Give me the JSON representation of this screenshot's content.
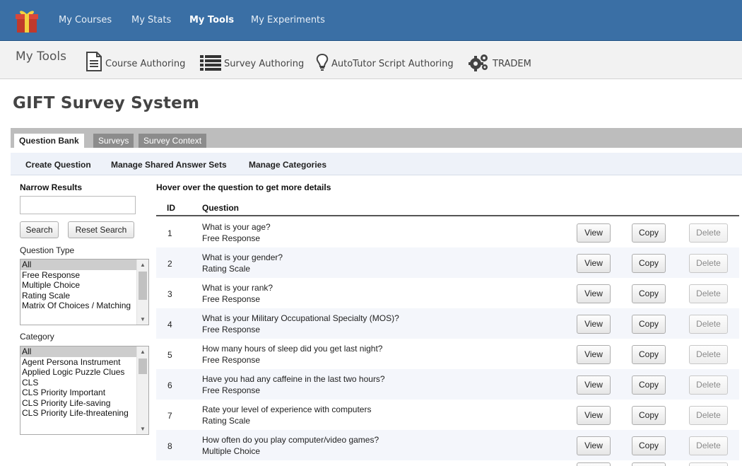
{
  "topnav": {
    "items": [
      {
        "label": "My Courses",
        "active": false
      },
      {
        "label": "My Stats",
        "active": false
      },
      {
        "label": "My Tools",
        "active": true
      },
      {
        "label": "My Experiments",
        "active": false
      }
    ]
  },
  "toolsbar": {
    "title": "My Tools",
    "tools": [
      {
        "label": "Course Authoring",
        "icon": "document-icon"
      },
      {
        "label": "Survey Authoring",
        "icon": "list-icon"
      },
      {
        "label": "AutoTutor Script Authoring",
        "icon": "lightbulb-icon"
      },
      {
        "label": "TRADEM",
        "icon": "gears-icon"
      }
    ]
  },
  "page": {
    "title": "GIFT Survey System"
  },
  "tabs": [
    {
      "label": "Question Bank",
      "active": true
    },
    {
      "label": "Surveys",
      "active": false
    },
    {
      "label": "Survey Context",
      "active": false
    }
  ],
  "actions": [
    "Create Question",
    "Manage Shared Answer Sets",
    "Manage Categories"
  ],
  "sidebar": {
    "title": "Narrow Results",
    "search_value": "",
    "search_button": "Search",
    "reset_button": "Reset Search",
    "question_type_label": "Question Type",
    "question_types": [
      "All",
      "Free Response",
      "Multiple Choice",
      "Rating Scale",
      "Matrix Of Choices / Matching"
    ],
    "category_label": "Category",
    "categories": [
      "All",
      "Agent Persona Instrument",
      "Applied Logic Puzzle Clues",
      "CLS",
      "CLS Priority Important",
      "CLS Priority Life-saving",
      "CLS Priority Life-threatening"
    ]
  },
  "table": {
    "hint": "Hover over the question to get more details",
    "columns": {
      "id": "ID",
      "question": "Question"
    },
    "buttons": {
      "view": "View",
      "copy": "Copy",
      "delete": "Delete"
    },
    "rows": [
      {
        "id": "1",
        "question": "What is your age?",
        "type": "Free Response"
      },
      {
        "id": "2",
        "question": "What is your gender?",
        "type": "Rating Scale"
      },
      {
        "id": "3",
        "question": "What is your rank?",
        "type": "Free Response"
      },
      {
        "id": "4",
        "question": "What is your Military Occupational Specialty (MOS)?",
        "type": "Free Response"
      },
      {
        "id": "5",
        "question": "How many hours of sleep did you get last night?",
        "type": "Free Response"
      },
      {
        "id": "6",
        "question": "Have you had any caffeine in the last two hours?",
        "type": "Free Response"
      },
      {
        "id": "7",
        "question": "Rate your level of experience with computers",
        "type": "Rating Scale"
      },
      {
        "id": "8",
        "question": "How often do you play computer/video games?",
        "type": "Multiple Choice"
      }
    ]
  },
  "colors": {
    "navbar": "#3a6fa5",
    "toolsbar": "#f2f2f2",
    "tabbar": "#bdbdbd",
    "subbar": "#eef2f9"
  }
}
